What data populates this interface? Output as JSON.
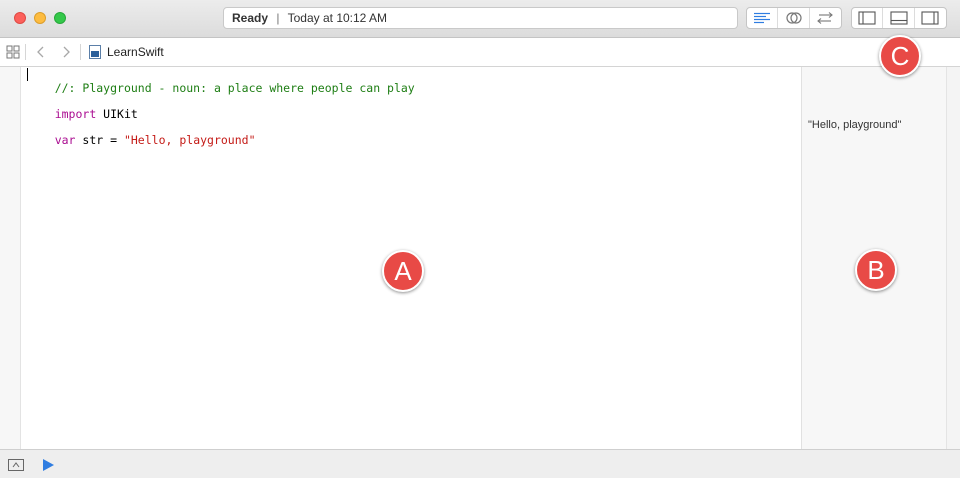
{
  "window": {
    "status_state": "Ready",
    "status_separator": "|",
    "status_time": "Today at 10:12 AM"
  },
  "toolbar": {
    "editor_buttons": [
      "standard-editor-icon",
      "assistant-editor-icon",
      "version-editor-icon"
    ],
    "view_buttons": [
      "navigator-panel-icon",
      "debug-area-icon",
      "utilities-panel-icon"
    ]
  },
  "jumpbar": {
    "file_name": "LearnSwift"
  },
  "editor": {
    "lines": {
      "comment": "//: Playground - noun: a place where people can play",
      "import_kw": "import",
      "import_name": " UIKit",
      "var_kw": "var",
      "var_mid": " str = ",
      "var_value": "\"Hello, playground\""
    }
  },
  "results": {
    "line3": "\"Hello, playground\""
  },
  "annotations": {
    "a": "A",
    "b": "B",
    "c": "C"
  },
  "colors": {
    "badge": "#e84a46",
    "comment": "#1e7e14",
    "keyword": "#aa0d91",
    "string": "#c41a16",
    "accent": "#2f7de1"
  }
}
